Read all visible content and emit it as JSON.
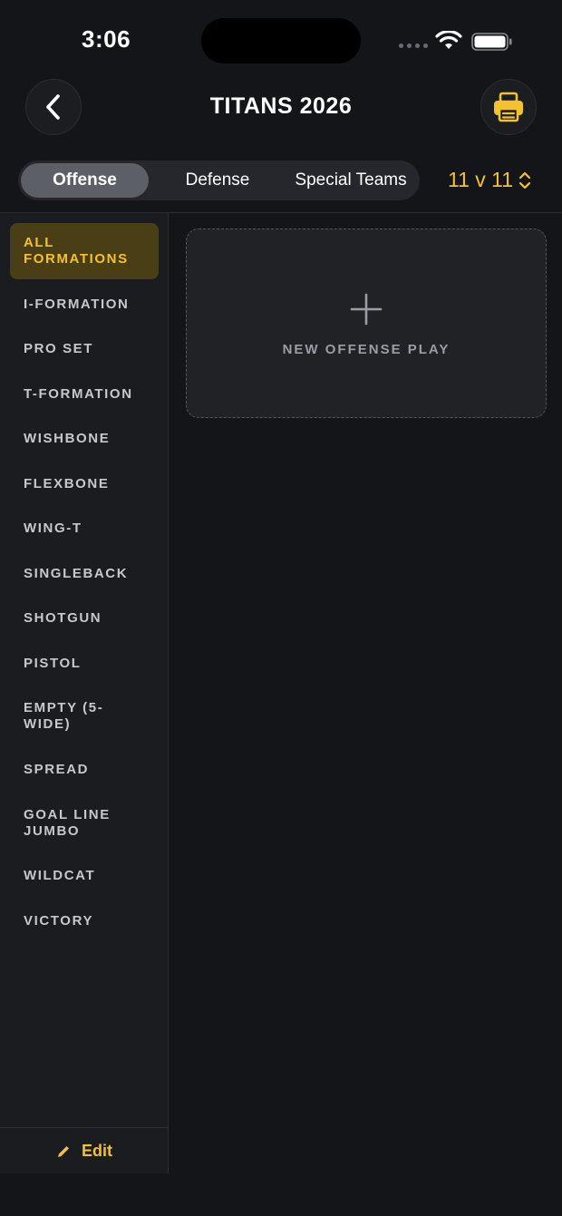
{
  "status_bar": {
    "time": "3:06"
  },
  "header": {
    "title": "TITANS 2026"
  },
  "tabs": [
    {
      "label": "Offense",
      "selected": true
    },
    {
      "label": "Defense",
      "selected": false
    },
    {
      "label": "Special Teams",
      "selected": false
    }
  ],
  "players": {
    "label": "11 v 11"
  },
  "sidebar": {
    "items": [
      {
        "label": "ALL FORMATIONS",
        "active": true
      },
      {
        "label": "I-FORMATION"
      },
      {
        "label": "PRO SET"
      },
      {
        "label": "T-FORMATION"
      },
      {
        "label": "WISHBONE"
      },
      {
        "label": "FLEXBONE"
      },
      {
        "label": "WING-T"
      },
      {
        "label": "SINGLEBACK"
      },
      {
        "label": "SHOTGUN"
      },
      {
        "label": "PISTOL"
      },
      {
        "label": "EMPTY (5-WIDE)"
      },
      {
        "label": "SPREAD"
      },
      {
        "label": "GOAL LINE JUMBO"
      },
      {
        "label": "WILDCAT"
      },
      {
        "label": "VICTORY"
      }
    ],
    "edit_label": "Edit"
  },
  "main": {
    "new_play_label": "NEW OFFENSE PLAY"
  },
  "colors": {
    "accent": "#f2c230",
    "background": "#141518",
    "sidebar": "#1b1c20",
    "active_item_bg": "#4a3e17"
  }
}
